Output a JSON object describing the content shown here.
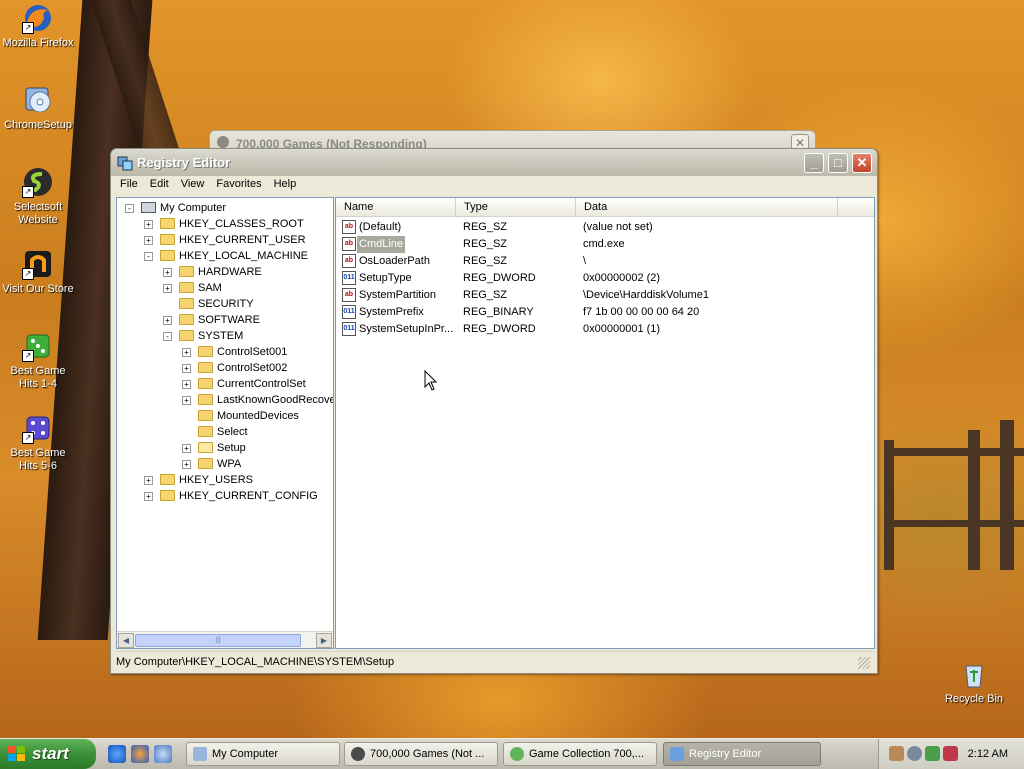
{
  "desktop": {
    "icons": [
      {
        "label": "Mozilla Firefox"
      },
      {
        "label": "ChromeSetup"
      },
      {
        "label": "Selectsoft Website"
      },
      {
        "label": "Visit Our Store"
      },
      {
        "label": "Best Game Hits 1-4"
      },
      {
        "label": "Best Game Hits 5-6"
      },
      {
        "label": "Recycle Bin"
      }
    ],
    "background_window_title": "700,000 Games (Not Responding)"
  },
  "registry_editor": {
    "title": "Registry Editor",
    "menu": [
      "File",
      "Edit",
      "View",
      "Favorites",
      "Help"
    ],
    "tree": [
      {
        "label": "My Computer",
        "expander": "-",
        "kind": "computer"
      },
      {
        "label": "HKEY_CLASSES_ROOT",
        "expander": "+"
      },
      {
        "label": "HKEY_CURRENT_USER",
        "expander": "+"
      },
      {
        "label": "HKEY_LOCAL_MACHINE",
        "expander": "-"
      },
      {
        "label": "HARDWARE",
        "expander": "+"
      },
      {
        "label": "SAM",
        "expander": "+"
      },
      {
        "label": "SECURITY",
        "expander": ""
      },
      {
        "label": "SOFTWARE",
        "expander": "+"
      },
      {
        "label": "SYSTEM",
        "expander": "-"
      },
      {
        "label": "ControlSet001",
        "expander": "+"
      },
      {
        "label": "ControlSet002",
        "expander": "+"
      },
      {
        "label": "CurrentControlSet",
        "expander": "+"
      },
      {
        "label": "LastKnownGoodRecove",
        "expander": "+"
      },
      {
        "label": "MountedDevices",
        "expander": ""
      },
      {
        "label": "Select",
        "expander": ""
      },
      {
        "label": "Setup",
        "expander": "+",
        "open": true
      },
      {
        "label": "WPA",
        "expander": "+"
      },
      {
        "label": "HKEY_USERS",
        "expander": "+"
      },
      {
        "label": "HKEY_CURRENT_CONFIG",
        "expander": "+"
      }
    ],
    "columns": [
      "Name",
      "Type",
      "Data"
    ],
    "values": [
      {
        "name": "(Default)",
        "type": "REG_SZ",
        "data": "(value not set)",
        "icon": "ab"
      },
      {
        "name": "CmdLine",
        "type": "REG_SZ",
        "data": "cmd.exe",
        "icon": "ab",
        "selected": true
      },
      {
        "name": "OsLoaderPath",
        "type": "REG_SZ",
        "data": "\\",
        "icon": "ab"
      },
      {
        "name": "SetupType",
        "type": "REG_DWORD",
        "data": "0x00000002 (2)",
        "icon": "bin"
      },
      {
        "name": "SystemPartition",
        "type": "REG_SZ",
        "data": "\\Device\\HarddiskVolume1",
        "icon": "ab"
      },
      {
        "name": "SystemPrefix",
        "type": "REG_BINARY",
        "data": "f7 1b 00 00 00 00 64 20",
        "icon": "bin"
      },
      {
        "name": "SystemSetupInPr...",
        "type": "REG_DWORD",
        "data": "0x00000001 (1)",
        "icon": "bin"
      }
    ],
    "status": "My Computer\\HKEY_LOCAL_MACHINE\\SYSTEM\\Setup",
    "scroll_grip": "|||"
  },
  "taskbar": {
    "start_label": "start",
    "tasks": [
      {
        "label": "My Computer",
        "active": false
      },
      {
        "label": "700,000 Games (Not ...",
        "active": false
      },
      {
        "label": "Game Collection 700,...",
        "active": false
      },
      {
        "label": "Registry Editor",
        "active": true
      }
    ],
    "clock": "2:12 AM"
  },
  "colors": {
    "start_green": "#3b9137",
    "window_face": "#ece9d8",
    "close_red": "#c2452a",
    "selection": "#a9a89c"
  }
}
